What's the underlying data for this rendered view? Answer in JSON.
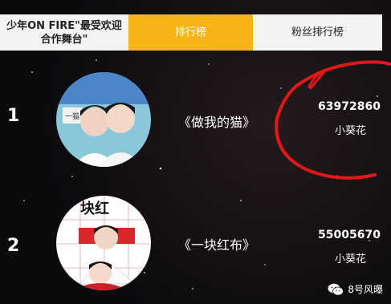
{
  "tabs": [
    {
      "label": "少年ON FIRE\"最受欢迎合作舞台\"",
      "active": false
    },
    {
      "label": "排行榜",
      "active": true
    },
    {
      "label": "粉丝排行榜",
      "active": false
    }
  ],
  "rankings": [
    {
      "rank": "1",
      "title": "《做我的猫》",
      "votes": "63972860",
      "fandom": "小葵花",
      "avatar_text": "一猫 分类"
    },
    {
      "rank": "2",
      "title": "《一块红布》",
      "votes": "55005670",
      "fandom": "小葵花",
      "avatar_text": "块红"
    }
  ],
  "watermark": {
    "text": "8号风曝",
    "icon": "wechat-icon"
  },
  "colors": {
    "active_tab": "#f7b417",
    "annotation": "#e3161a"
  }
}
